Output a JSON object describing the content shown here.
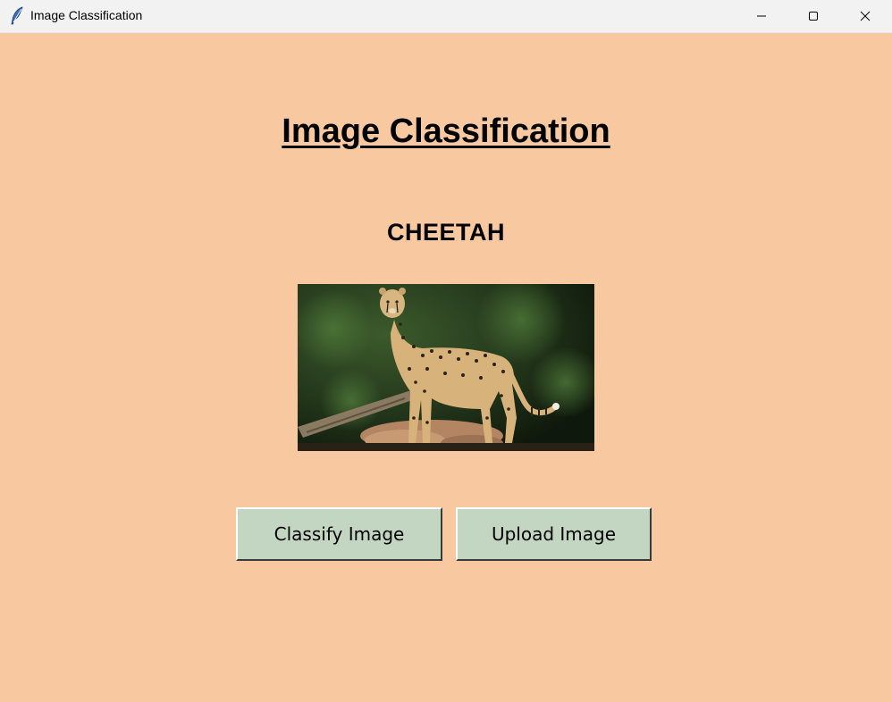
{
  "window": {
    "title": "Image Classification",
    "background": "#F8C8A0",
    "icon": "feather-icon",
    "controls": [
      "minimize-icon",
      "maximize-icon",
      "close-icon"
    ]
  },
  "main": {
    "heading": "Image Classification",
    "result": "CHEETAH",
    "image": {
      "subject": "cheetah-photo"
    }
  },
  "buttons": {
    "classify_label": "Classify Image",
    "upload_label": "Upload Image",
    "color": "#C3D6C1"
  }
}
